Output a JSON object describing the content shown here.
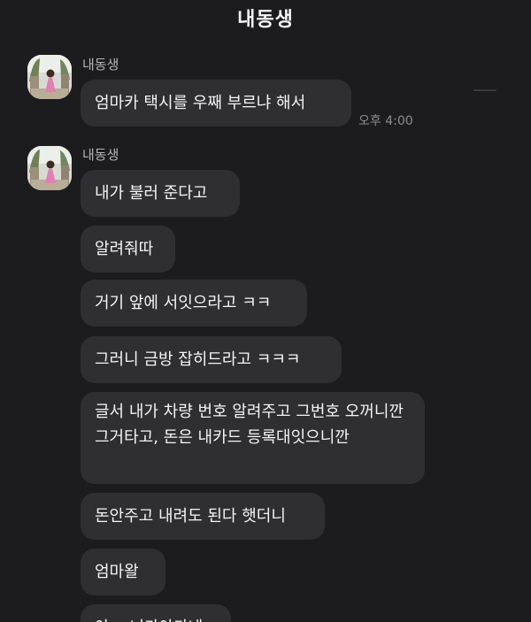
{
  "header": {
    "title": "내동생"
  },
  "groups": [
    {
      "sender": "내동생",
      "avatar_icon": "profile-photo-icon",
      "messages": [
        {
          "text": "엄마카 택시를 우째 부르냐 해서",
          "time": "오후 4:00"
        }
      ]
    },
    {
      "sender": "내동생",
      "avatar_icon": "profile-photo-icon",
      "messages": [
        {
          "text": "내가 불러 준다고"
        },
        {
          "text": "알려줘따"
        },
        {
          "text": "거기 앞에 서잇으라고 ㅋㅋ"
        },
        {
          "text": "그러니 금방 잡히드라고 ㅋㅋㅋ"
        },
        {
          "text": "글서 내가 차량 번호 알려주고 그번호 오꺼니깐 그거타고, 돈은 내카드 등록대잇으니깐"
        },
        {
          "text": "돈안주고 내려도 된다 햇더니"
        },
        {
          "text": "엄마왈"
        },
        {
          "text": "아... 니카아카네"
        }
      ]
    }
  ],
  "colors": {
    "background": "#1c1c1e",
    "bubble": "#2f2f31",
    "text": "#f4f4f4",
    "sender": "#b4b4b4",
    "time": "#8d8d8d"
  }
}
